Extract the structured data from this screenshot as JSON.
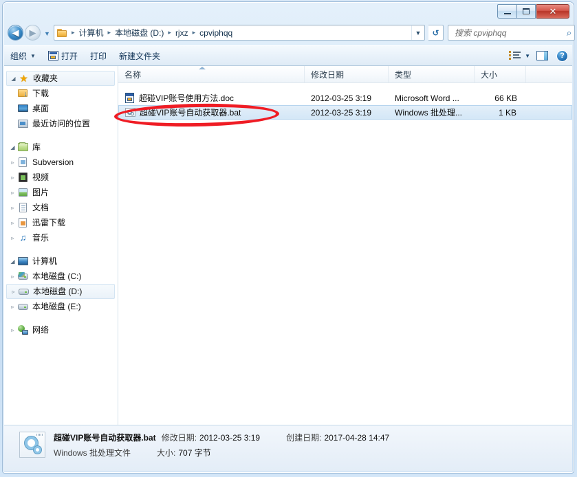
{
  "window": {
    "buttons": {
      "minimize": "minimize",
      "maximize": "maximize",
      "close": "✕"
    }
  },
  "navbar": {
    "back_glyph": "◀",
    "forward_glyph": "▶",
    "history_caret": "▼",
    "breadcrumb": [
      "计算机",
      "本地磁盘 (D:)",
      "rjxz",
      "cpviphqq"
    ],
    "separator": "▸",
    "address_caret": "▼",
    "refresh_glyph": "↺",
    "search_placeholder": "搜索 cpviphqq",
    "search_value": "",
    "search_glyph": "⌕"
  },
  "commandbar": {
    "organize": "组织",
    "organize_caret": "▼",
    "open": "打开",
    "print": "打印",
    "new_folder": "新建文件夹",
    "view_caret": "▼",
    "help_glyph": "?"
  },
  "navpane": {
    "groups": [
      {
        "header": {
          "label": "收藏夹",
          "icon": "star-icon",
          "expander": "◢",
          "selected": true
        },
        "items": [
          {
            "label": "下载",
            "icon": "downloads-folder-icon",
            "expander": ""
          },
          {
            "label": "桌面",
            "icon": "desktop-icon",
            "expander": ""
          },
          {
            "label": "最近访问的位置",
            "icon": "recent-places-icon",
            "expander": ""
          }
        ]
      },
      {
        "header": {
          "label": "库",
          "icon": "library-icon",
          "expander": "◢",
          "selected": false
        },
        "items": [
          {
            "label": "Subversion",
            "icon": "subversion-library-icon",
            "expander": "▹"
          },
          {
            "label": "视频",
            "icon": "videos-library-icon",
            "expander": "▹"
          },
          {
            "label": "图片",
            "icon": "pictures-library-icon",
            "expander": "▹"
          },
          {
            "label": "文档",
            "icon": "documents-library-icon",
            "expander": "▹"
          },
          {
            "label": "迅雷下载",
            "icon": "xunlei-library-icon",
            "expander": "▹"
          },
          {
            "label": "音乐",
            "icon": "music-library-icon",
            "expander": "▹"
          }
        ]
      },
      {
        "header": {
          "label": "计算机",
          "icon": "computer-icon",
          "expander": "◢",
          "selected": false
        },
        "items": [
          {
            "label": "本地磁盘 (C:)",
            "icon": "system-drive-icon",
            "expander": "▹"
          },
          {
            "label": "本地磁盘 (D:)",
            "icon": "drive-icon",
            "expander": "▹",
            "selected": true
          },
          {
            "label": "本地磁盘 (E:)",
            "icon": "drive-icon",
            "expander": "▹"
          }
        ]
      },
      {
        "header": {
          "label": "网络",
          "icon": "network-icon",
          "expander": "▹",
          "selected": false
        },
        "items": []
      }
    ]
  },
  "filelist": {
    "columns": [
      {
        "label": "名称",
        "key": "name"
      },
      {
        "label": "修改日期",
        "key": "modified"
      },
      {
        "label": "类型",
        "key": "type"
      },
      {
        "label": "大小",
        "key": "size"
      }
    ],
    "sorted_column": "名称",
    "sort_direction": "ascending",
    "rows": [
      {
        "name": "超碰VIP账号使用方法.doc",
        "modified": "2012-03-25 3:19",
        "type": "Microsoft Word ...",
        "size": "66 KB",
        "icon": "word-document-icon",
        "selected": false
      },
      {
        "name": "超碰VIP账号自动获取器.bat",
        "modified": "2012-03-25 3:19",
        "type": "Windows 批处理...",
        "size": "1 KB",
        "icon": "batch-file-icon",
        "selected": true
      }
    ]
  },
  "annotation": {
    "shape": "ellipse",
    "color": "#ef1c24",
    "target": "超碰VIP账号自动获取器.bat"
  },
  "details": {
    "filename": "超碰VIP账号自动获取器.bat",
    "modified_label": "修改日期:",
    "modified_value": "2012-03-25 3:19",
    "created_label": "创建日期:",
    "created_value": "2017-04-28 14:47",
    "filetype": "Windows 批处理文件",
    "size_label": "大小:",
    "size_value": "707 字节"
  }
}
